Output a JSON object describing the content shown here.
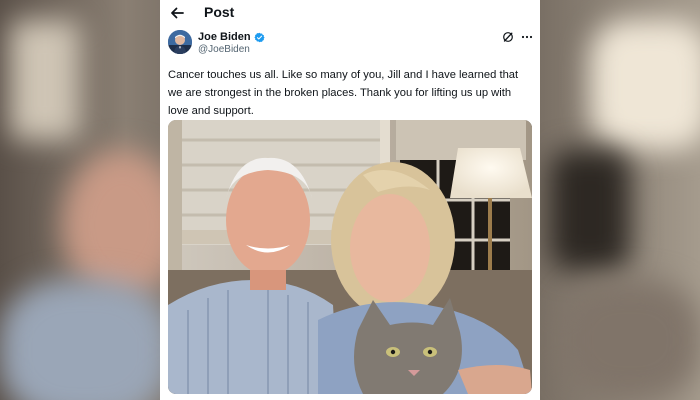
{
  "header": {
    "title": "Post"
  },
  "post": {
    "author_name": "Joe Biden",
    "handle": "@JoeBiden",
    "text": "Cancer touches us all. Like so many of you, Jill and I have learned that we are strongest in the broken places. Thank you for lifting us up with love and support."
  },
  "icons": {
    "back": "arrow-left-icon",
    "verified": "verified-badge-icon",
    "grok": "grok-icon",
    "more": "more-horizontal-icon"
  },
  "colors": {
    "verified_blue": "#1d9bf0",
    "text_primary": "#0f1419",
    "text_secondary": "#536471"
  }
}
